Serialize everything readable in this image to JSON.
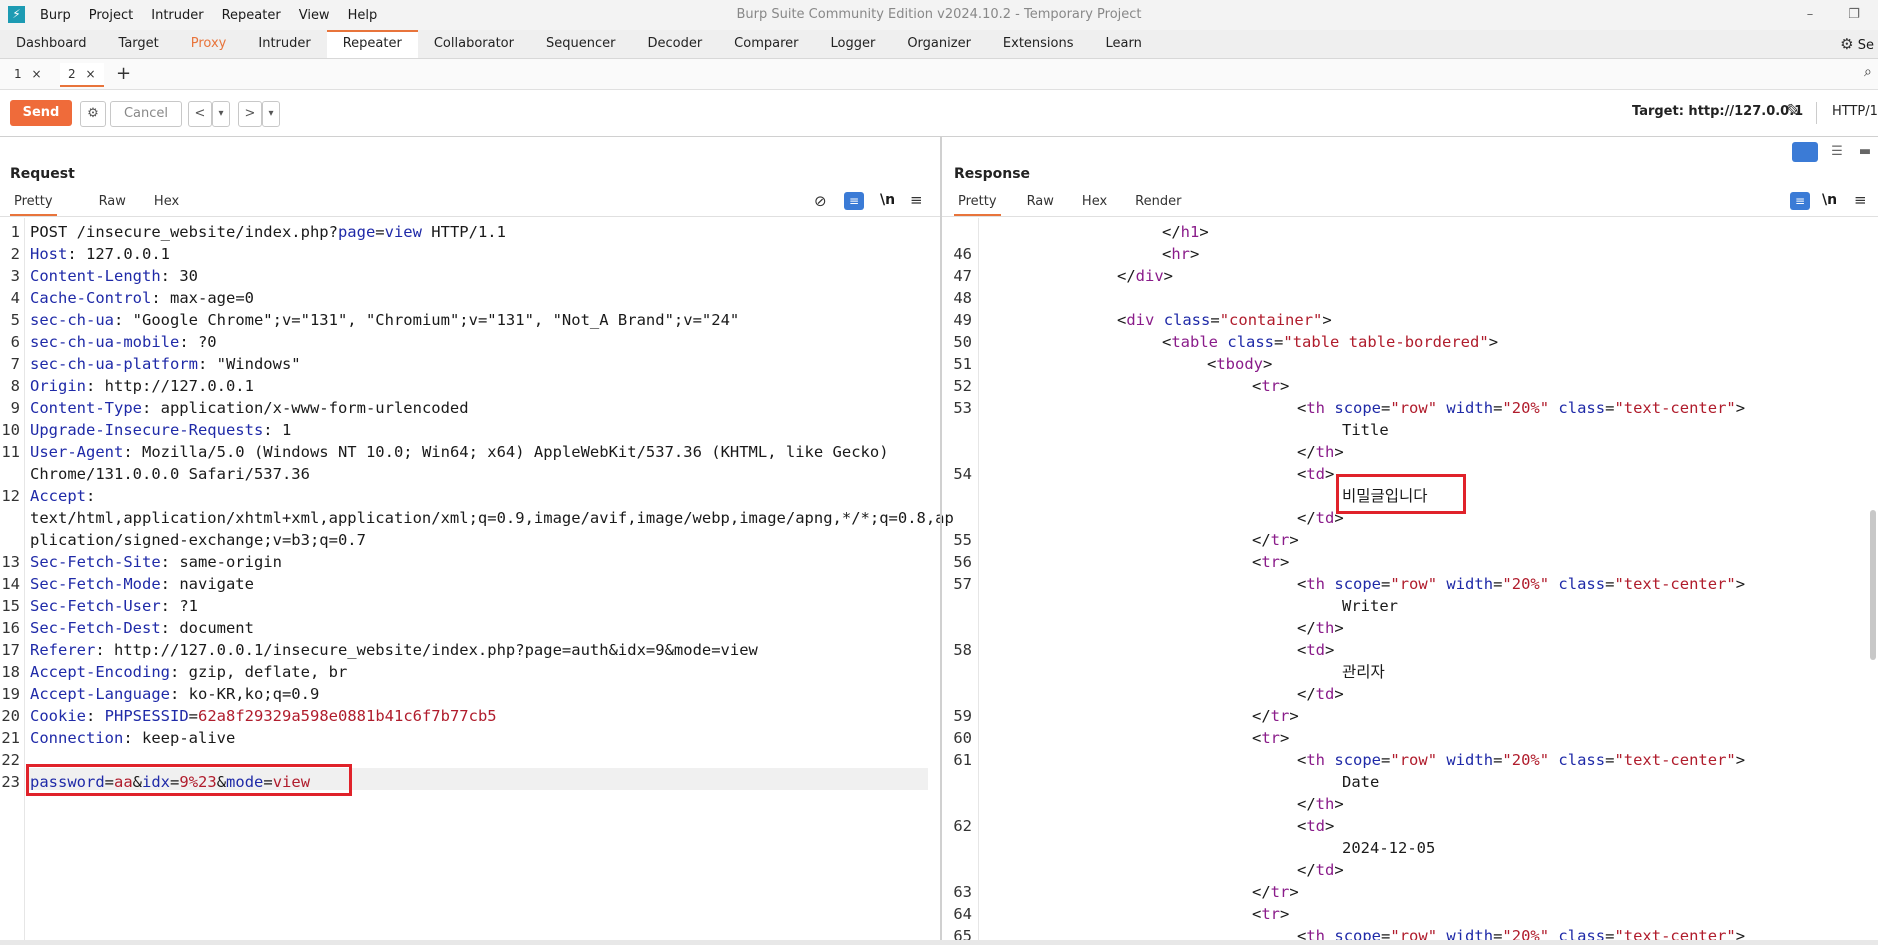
{
  "app": {
    "title": "Burp Suite Community Edition v2024.10.2 - Temporary Project",
    "logo_glyph": "⚡",
    "menu": [
      "Burp",
      "Project",
      "Intruder",
      "Repeater",
      "View",
      "Help"
    ],
    "win_minimize": "–",
    "win_restore": "❐"
  },
  "tools_tabs": [
    "Dashboard",
    "Target",
    "Proxy",
    "Intruder",
    "Repeater",
    "Collaborator",
    "Sequencer",
    "Decoder",
    "Comparer",
    "Logger",
    "Organizer",
    "Extensions",
    "Learn"
  ],
  "active_tool": "Repeater",
  "settings_label": "Se",
  "repeater_tabs": [
    {
      "label": "1",
      "close": "×"
    },
    {
      "label": "2",
      "close": "×"
    }
  ],
  "add_tab": "+",
  "toolbar": {
    "send": "Send",
    "cancel": "Cancel",
    "back": "<",
    "forward": ">",
    "dropdown": "▾",
    "target": "Target: http://127.0.0.1",
    "http": "HTTP/1"
  },
  "request": {
    "title": "Request",
    "tabs": [
      "Pretty",
      "Raw",
      "Hex"
    ],
    "newline_label": "\\n",
    "menu_glyph": "≡",
    "lines": [
      {
        "n": "1",
        "parts": [
          [
            "t",
            "POST /insecure_website/index.php?"
          ],
          [
            "k",
            "page"
          ],
          [
            "t",
            "="
          ],
          [
            "k",
            "view"
          ],
          [
            "t",
            " HTTP/1.1"
          ]
        ]
      },
      {
        "n": "2",
        "parts": [
          [
            "k",
            "Host"
          ],
          [
            "t",
            ": 127.0.0.1"
          ]
        ]
      },
      {
        "n": "3",
        "parts": [
          [
            "k",
            "Content-Length"
          ],
          [
            "t",
            ": 30"
          ]
        ]
      },
      {
        "n": "4",
        "parts": [
          [
            "k",
            "Cache-Control"
          ],
          [
            "t",
            ": max-age=0"
          ]
        ]
      },
      {
        "n": "5",
        "parts": [
          [
            "k",
            "sec-ch-ua"
          ],
          [
            "t",
            ": \"Google Chrome\";v=\"131\", \"Chromium\";v=\"131\", \"Not_A Brand\";v=\"24\""
          ]
        ]
      },
      {
        "n": "6",
        "parts": [
          [
            "k",
            "sec-ch-ua-mobile"
          ],
          [
            "t",
            ": ?0"
          ]
        ]
      },
      {
        "n": "7",
        "parts": [
          [
            "k",
            "sec-ch-ua-platform"
          ],
          [
            "t",
            ": \"Windows\""
          ]
        ]
      },
      {
        "n": "8",
        "parts": [
          [
            "k",
            "Origin"
          ],
          [
            "t",
            ": http://127.0.0.1"
          ]
        ]
      },
      {
        "n": "9",
        "parts": [
          [
            "k",
            "Content-Type"
          ],
          [
            "t",
            ": application/x-www-form-urlencoded"
          ]
        ]
      },
      {
        "n": "10",
        "parts": [
          [
            "k",
            "Upgrade-Insecure-Requests"
          ],
          [
            "t",
            ": 1"
          ]
        ]
      },
      {
        "n": "11",
        "parts": [
          [
            "k",
            "User-Agent"
          ],
          [
            "t",
            ": Mozilla/5.0 (Windows NT 10.0; Win64; x64) AppleWebKit/537.36 (KHTML, like Gecko)"
          ]
        ]
      },
      {
        "n": "",
        "parts": [
          [
            "t",
            "Chrome/131.0.0.0 Safari/537.36"
          ]
        ]
      },
      {
        "n": "12",
        "parts": [
          [
            "k",
            "Accept"
          ],
          [
            "t",
            ":"
          ]
        ]
      },
      {
        "n": "",
        "parts": [
          [
            "t",
            "text/html,application/xhtml+xml,application/xml;q=0.9,image/avif,image/webp,image/apng,*/*;q=0.8,ap"
          ]
        ]
      },
      {
        "n": "",
        "parts": [
          [
            "t",
            "plication/signed-exchange;v=b3;q=0.7"
          ]
        ]
      },
      {
        "n": "13",
        "parts": [
          [
            "k",
            "Sec-Fetch-Site"
          ],
          [
            "t",
            ": same-origin"
          ]
        ]
      },
      {
        "n": "14",
        "parts": [
          [
            "k",
            "Sec-Fetch-Mode"
          ],
          [
            "t",
            ": navigate"
          ]
        ]
      },
      {
        "n": "15",
        "parts": [
          [
            "k",
            "Sec-Fetch-User"
          ],
          [
            "t",
            ": ?1"
          ]
        ]
      },
      {
        "n": "16",
        "parts": [
          [
            "k",
            "Sec-Fetch-Dest"
          ],
          [
            "t",
            ": document"
          ]
        ]
      },
      {
        "n": "17",
        "parts": [
          [
            "k",
            "Referer"
          ],
          [
            "t",
            ": http://127.0.0.1/insecure_website/index.php?page=auth&idx=9&mode=view"
          ]
        ]
      },
      {
        "n": "18",
        "parts": [
          [
            "k",
            "Accept-Encoding"
          ],
          [
            "t",
            ": gzip, deflate, br"
          ]
        ]
      },
      {
        "n": "19",
        "parts": [
          [
            "k",
            "Accept-Language"
          ],
          [
            "t",
            ": ko-KR,ko;q=0.9"
          ]
        ]
      },
      {
        "n": "20",
        "parts": [
          [
            "k",
            "Cookie"
          ],
          [
            "t",
            ": "
          ],
          [
            "k",
            "PHPSESSID"
          ],
          [
            "t",
            "="
          ],
          [
            "v",
            "62a8f29329a598e0881b41c6f7b77cb5"
          ]
        ]
      },
      {
        "n": "21",
        "parts": [
          [
            "k",
            "Connection"
          ],
          [
            "t",
            ": keep-alive"
          ]
        ]
      },
      {
        "n": "22",
        "parts": []
      },
      {
        "n": "23",
        "parts": [
          [
            "k",
            "password"
          ],
          [
            "t",
            "="
          ],
          [
            "v",
            "aa"
          ],
          [
            "t",
            "&"
          ],
          [
            "k",
            "idx"
          ],
          [
            "t",
            "="
          ],
          [
            "v",
            "9%23"
          ],
          [
            "t",
            "&"
          ],
          [
            "k",
            "mode"
          ],
          [
            "t",
            "="
          ],
          [
            "v",
            "view"
          ]
        ]
      }
    ]
  },
  "response": {
    "title": "Response",
    "tabs": [
      "Pretty",
      "Raw",
      "Hex",
      "Render"
    ],
    "newline_label": "\\n",
    "menu_glyph": "≡",
    "lines": [
      {
        "n": "",
        "i": 4,
        "parts": [
          [
            "g",
            "</"
          ],
          [
            "tag",
            "h1"
          ],
          [
            "g",
            ">"
          ]
        ]
      },
      {
        "n": "46",
        "i": 4,
        "parts": [
          [
            "g",
            "<"
          ],
          [
            "tag",
            "hr"
          ],
          [
            "g",
            ">"
          ]
        ]
      },
      {
        "n": "47",
        "i": 3,
        "parts": [
          [
            "g",
            "</"
          ],
          [
            "tag",
            "div"
          ],
          [
            "g",
            ">"
          ]
        ]
      },
      {
        "n": "48",
        "i": 0,
        "parts": []
      },
      {
        "n": "49",
        "i": 3,
        "parts": [
          [
            "g",
            "<"
          ],
          [
            "tag",
            "div"
          ],
          [
            "g",
            " "
          ],
          [
            "attr",
            "class"
          ],
          [
            "g",
            "="
          ],
          [
            "str",
            "\"container\""
          ],
          [
            "g",
            ">"
          ]
        ]
      },
      {
        "n": "50",
        "i": 4,
        "parts": [
          [
            "g",
            "<"
          ],
          [
            "tag",
            "table"
          ],
          [
            "g",
            " "
          ],
          [
            "attr",
            "class"
          ],
          [
            "g",
            "="
          ],
          [
            "str",
            "\"table table-bordered\""
          ],
          [
            "g",
            ">"
          ]
        ]
      },
      {
        "n": "51",
        "i": 5,
        "parts": [
          [
            "g",
            "<"
          ],
          [
            "tag",
            "tbody"
          ],
          [
            "g",
            ">"
          ]
        ]
      },
      {
        "n": "52",
        "i": 6,
        "parts": [
          [
            "g",
            "<"
          ],
          [
            "tag",
            "tr"
          ],
          [
            "g",
            ">"
          ]
        ]
      },
      {
        "n": "53",
        "i": 7,
        "parts": [
          [
            "g",
            "<"
          ],
          [
            "tag",
            "th"
          ],
          [
            "g",
            " "
          ],
          [
            "attr",
            "scope"
          ],
          [
            "g",
            "="
          ],
          [
            "str",
            "\"row\""
          ],
          [
            "g",
            " "
          ],
          [
            "attr",
            "width"
          ],
          [
            "g",
            "="
          ],
          [
            "str",
            "\"20%\""
          ],
          [
            "g",
            " "
          ],
          [
            "attr",
            "class"
          ],
          [
            "g",
            "="
          ],
          [
            "str",
            "\"text-center\""
          ],
          [
            "g",
            ">"
          ]
        ]
      },
      {
        "n": "",
        "i": 8,
        "parts": [
          [
            "g",
            "Title"
          ]
        ]
      },
      {
        "n": "",
        "i": 7,
        "parts": [
          [
            "g",
            "</"
          ],
          [
            "tag",
            "th"
          ],
          [
            "g",
            ">"
          ]
        ]
      },
      {
        "n": "54",
        "i": 7,
        "parts": [
          [
            "g",
            "<"
          ],
          [
            "tag",
            "td"
          ],
          [
            "g",
            ">"
          ]
        ]
      },
      {
        "n": "",
        "i": 8,
        "parts": [
          [
            "g",
            "비밀글입니다"
          ]
        ]
      },
      {
        "n": "",
        "i": 7,
        "parts": [
          [
            "g",
            "</"
          ],
          [
            "tag",
            "td"
          ],
          [
            "g",
            ">"
          ]
        ]
      },
      {
        "n": "55",
        "i": 6,
        "parts": [
          [
            "g",
            "</"
          ],
          [
            "tag",
            "tr"
          ],
          [
            "g",
            ">"
          ]
        ]
      },
      {
        "n": "56",
        "i": 6,
        "parts": [
          [
            "g",
            "<"
          ],
          [
            "tag",
            "tr"
          ],
          [
            "g",
            ">"
          ]
        ]
      },
      {
        "n": "57",
        "i": 7,
        "parts": [
          [
            "g",
            "<"
          ],
          [
            "tag",
            "th"
          ],
          [
            "g",
            " "
          ],
          [
            "attr",
            "scope"
          ],
          [
            "g",
            "="
          ],
          [
            "str",
            "\"row\""
          ],
          [
            "g",
            " "
          ],
          [
            "attr",
            "width"
          ],
          [
            "g",
            "="
          ],
          [
            "str",
            "\"20%\""
          ],
          [
            "g",
            " "
          ],
          [
            "attr",
            "class"
          ],
          [
            "g",
            "="
          ],
          [
            "str",
            "\"text-center\""
          ],
          [
            "g",
            ">"
          ]
        ]
      },
      {
        "n": "",
        "i": 8,
        "parts": [
          [
            "g",
            "Writer"
          ]
        ]
      },
      {
        "n": "",
        "i": 7,
        "parts": [
          [
            "g",
            "</"
          ],
          [
            "tag",
            "th"
          ],
          [
            "g",
            ">"
          ]
        ]
      },
      {
        "n": "58",
        "i": 7,
        "parts": [
          [
            "g",
            "<"
          ],
          [
            "tag",
            "td"
          ],
          [
            "g",
            ">"
          ]
        ]
      },
      {
        "n": "",
        "i": 8,
        "parts": [
          [
            "g",
            "관리자"
          ]
        ]
      },
      {
        "n": "",
        "i": 7,
        "parts": [
          [
            "g",
            "</"
          ],
          [
            "tag",
            "td"
          ],
          [
            "g",
            ">"
          ]
        ]
      },
      {
        "n": "59",
        "i": 6,
        "parts": [
          [
            "g",
            "</"
          ],
          [
            "tag",
            "tr"
          ],
          [
            "g",
            ">"
          ]
        ]
      },
      {
        "n": "60",
        "i": 6,
        "parts": [
          [
            "g",
            "<"
          ],
          [
            "tag",
            "tr"
          ],
          [
            "g",
            ">"
          ]
        ]
      },
      {
        "n": "61",
        "i": 7,
        "parts": [
          [
            "g",
            "<"
          ],
          [
            "tag",
            "th"
          ],
          [
            "g",
            " "
          ],
          [
            "attr",
            "scope"
          ],
          [
            "g",
            "="
          ],
          [
            "str",
            "\"row\""
          ],
          [
            "g",
            " "
          ],
          [
            "attr",
            "width"
          ],
          [
            "g",
            "="
          ],
          [
            "str",
            "\"20%\""
          ],
          [
            "g",
            " "
          ],
          [
            "attr",
            "class"
          ],
          [
            "g",
            "="
          ],
          [
            "str",
            "\"text-center\""
          ],
          [
            "g",
            ">"
          ]
        ]
      },
      {
        "n": "",
        "i": 8,
        "parts": [
          [
            "g",
            "Date"
          ]
        ]
      },
      {
        "n": "",
        "i": 7,
        "parts": [
          [
            "g",
            "</"
          ],
          [
            "tag",
            "th"
          ],
          [
            "g",
            ">"
          ]
        ]
      },
      {
        "n": "62",
        "i": 7,
        "parts": [
          [
            "g",
            "<"
          ],
          [
            "tag",
            "td"
          ],
          [
            "g",
            ">"
          ]
        ]
      },
      {
        "n": "",
        "i": 8,
        "parts": [
          [
            "g",
            "2024-12-05"
          ]
        ]
      },
      {
        "n": "",
        "i": 7,
        "parts": [
          [
            "g",
            "</"
          ],
          [
            "tag",
            "td"
          ],
          [
            "g",
            ">"
          ]
        ]
      },
      {
        "n": "63",
        "i": 6,
        "parts": [
          [
            "g",
            "</"
          ],
          [
            "tag",
            "tr"
          ],
          [
            "g",
            ">"
          ]
        ]
      },
      {
        "n": "64",
        "i": 6,
        "parts": [
          [
            "g",
            "<"
          ],
          [
            "tag",
            "tr"
          ],
          [
            "g",
            ">"
          ]
        ]
      },
      {
        "n": "65",
        "i": 7,
        "parts": [
          [
            "g",
            "<"
          ],
          [
            "tag",
            "th"
          ],
          [
            "g",
            " "
          ],
          [
            "attr",
            "scope"
          ],
          [
            "g",
            "="
          ],
          [
            "str",
            "\"row\""
          ],
          [
            "g",
            " "
          ],
          [
            "attr",
            "width"
          ],
          [
            "g",
            "="
          ],
          [
            "str",
            "\"20%\""
          ],
          [
            "g",
            " "
          ],
          [
            "attr",
            "class"
          ],
          [
            "g",
            "="
          ],
          [
            "str",
            "\"text-center\""
          ],
          [
            "g",
            ">"
          ]
        ]
      }
    ]
  },
  "colors": {
    "accent": "#e8743b",
    "key": "#1f2aa8",
    "value": "#b01c2c",
    "tag": "#8a1c8a",
    "highlight": "#e0222a"
  }
}
